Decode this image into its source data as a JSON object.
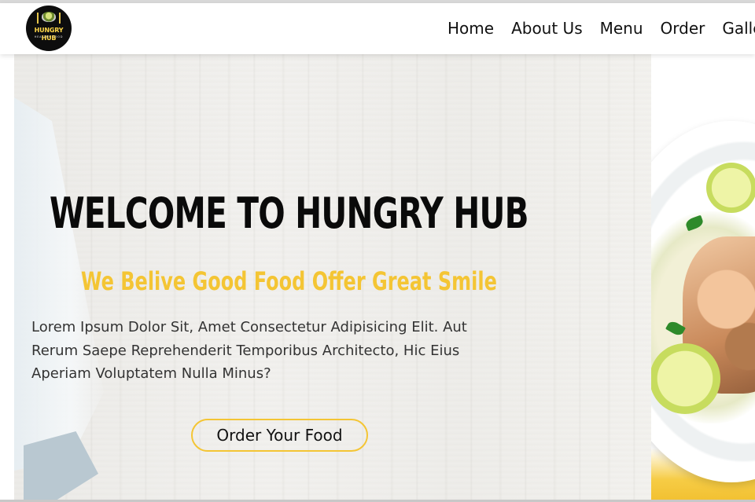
{
  "header": {
    "logo": {
      "brand_text": "HUNGRY HUB",
      "tagline": "HEALTHY FOOD"
    },
    "nav": {
      "items": [
        "Home",
        "About Us",
        "Menu",
        "Order",
        "Galle"
      ]
    }
  },
  "hero": {
    "title": "WELCOME TO HUNGRY HUB",
    "subtitle": "We Belive Good Food Offer Great Smile",
    "description": "Lorem Ipsum Dolor Sit, Amet Consectetur Adipisicing Elit. Aut Rerum Saepe Reprehenderit Temporibus Architecto, Hic Eius Aperiam Voluptatem Nulla Minus?",
    "cta_label": "Order Your Food"
  },
  "colors": {
    "accent": "#f4c534",
    "text_dark": "#0a0a0a",
    "body_text": "#333333",
    "background": "#ffffff"
  }
}
